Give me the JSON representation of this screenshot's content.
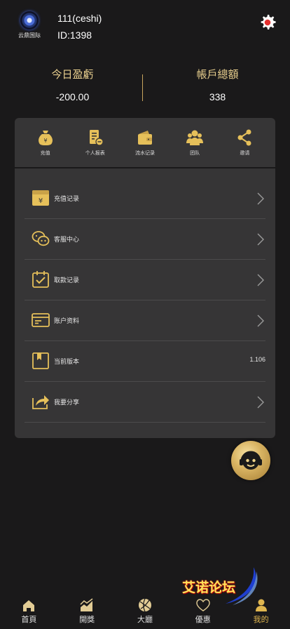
{
  "header": {
    "logo_text": "云鼎国际",
    "username": "111(ceshi)",
    "user_id": "ID:1398"
  },
  "stats": {
    "today_label": "今日盈虧",
    "today_value": "-200.00",
    "total_label": "帳戶總額",
    "total_value": "338"
  },
  "quick_menu": [
    {
      "label": "充值",
      "icon": "money-bag-icon"
    },
    {
      "label": "个人报表",
      "icon": "report-icon"
    },
    {
      "label": "流水记录",
      "icon": "wallet-icon"
    },
    {
      "label": "团队",
      "icon": "team-icon"
    },
    {
      "label": "邀请",
      "icon": "share-icon"
    }
  ],
  "menu_list": [
    {
      "label": "充值记录",
      "icon": "recharge-record-icon"
    },
    {
      "label": "客服中心",
      "icon": "chat-icon"
    },
    {
      "label": "取款记录",
      "icon": "calendar-check-icon"
    },
    {
      "label": "账户资料",
      "icon": "card-icon"
    },
    {
      "label": "当前版本",
      "icon": "bookmark-icon",
      "value": "1.106"
    },
    {
      "label": "我要分享",
      "icon": "share-arrow-icon"
    }
  ],
  "watermark": "艾诺论坛",
  "tabs": [
    {
      "label": "首頁",
      "icon": "home-icon"
    },
    {
      "label": "開獎",
      "icon": "chart-icon"
    },
    {
      "label": "大廳",
      "icon": "ball-icon"
    },
    {
      "label": "優惠",
      "icon": "heart-icon"
    },
    {
      "label": "我的",
      "icon": "user-icon",
      "active": true
    }
  ],
  "colors": {
    "background": "#1a191a",
    "panel": "#363536",
    "gold": "#e0b64f",
    "accent_red": "#e5302f"
  }
}
